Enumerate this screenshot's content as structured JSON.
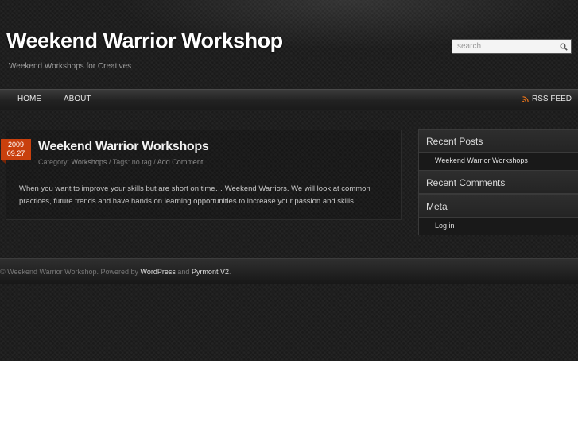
{
  "header": {
    "title": "Weekend Warrior Workshop",
    "tagline": "Weekend Workshops for Creatives",
    "search_placeholder": "search"
  },
  "nav": {
    "items": [
      {
        "label": "HOME"
      },
      {
        "label": "ABOUT"
      }
    ],
    "rss_label": "RSS FEED"
  },
  "post": {
    "date_year": "2009",
    "date_monthday": "09.27",
    "title": "Weekend Warrior Workshops",
    "meta": {
      "category_prefix": "Category: ",
      "category": "Workshops",
      "sep1": " / ",
      "tags_prefix": "Tags: ",
      "tags": "no tag",
      "sep2": " / ",
      "comment_link": "Add Comment"
    },
    "body": "When you want to improve your skills but are short on time… Weekend Warriors. We will look at common practices, future trends and have hands on learning opportunities to increase your passion and skills."
  },
  "sidebar": {
    "recent_posts": {
      "heading": "Recent Posts",
      "items": [
        "Weekend Warrior Workshops"
      ]
    },
    "recent_comments": {
      "heading": "Recent Comments"
    },
    "meta": {
      "heading": "Meta",
      "items": [
        "Log in"
      ]
    }
  },
  "footer": {
    "prefix": "© Weekend Warrior Workshop. Powered by ",
    "wordpress": "WordPress",
    "and": " and ",
    "theme": "Pyrmont V2",
    "end": "."
  },
  "colors": {
    "background": "#1c1c1c",
    "accent_date": "#c9400d",
    "rss_orange": "#e8731a"
  },
  "icons": {
    "search": "search-icon",
    "rss": "rss-icon"
  }
}
